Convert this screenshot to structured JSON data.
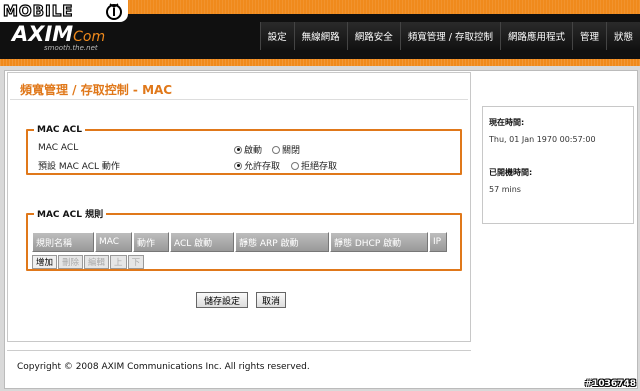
{
  "header": {
    "badge_text": "MOBILE",
    "logo_main": "AXIM",
    "logo_com": "Com",
    "logo_tagline": "smooth.the.net",
    "accent_color": "#f08a1c",
    "nav": [
      "設定",
      "無線網路",
      "網路安全",
      "頻寬管理 / 存取控制",
      "網路應用程式",
      "管理",
      "狀態"
    ]
  },
  "page": {
    "title": "頻寬管理 / 存取控制 - MAC"
  },
  "mac_acl": {
    "legend": "MAC ACL",
    "rows": [
      {
        "label": "MAC ACL",
        "options": [
          "啟動",
          "關閉"
        ],
        "selected": 0
      },
      {
        "label": "預設 MAC ACL 動作",
        "options": [
          "允許存取",
          "拒絕存取"
        ],
        "selected": 0
      }
    ]
  },
  "rules": {
    "legend": "MAC ACL 規則",
    "columns": [
      "規則名稱",
      "MAC",
      "動作",
      "ACL 啟動",
      "靜態 ARP 啟動",
      "靜態 DHCP 啟動",
      "IP"
    ],
    "buttons": [
      "增加",
      "刪除",
      "編輯",
      "上",
      "下"
    ]
  },
  "actions": {
    "save": "儲存設定",
    "cancel": "取消"
  },
  "status": {
    "time_label": "現在時間:",
    "time_value": "Thu, 01 Jan 1970 00:57:00",
    "uptime_label": "已開機時間:",
    "uptime_value": "57 mins"
  },
  "footer": {
    "copyright": "Copyright © 2008 AXIM Communications Inc. All rights reserved."
  },
  "watermark": "#1036748"
}
